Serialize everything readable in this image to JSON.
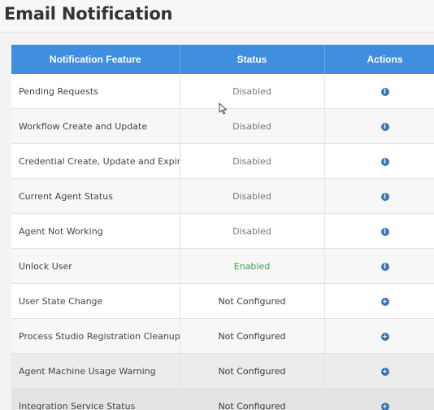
{
  "page": {
    "title": "Email Notification"
  },
  "table": {
    "headers": [
      "Notification Feature",
      "Status",
      "Actions"
    ],
    "rows": [
      {
        "feature": "Pending Requests",
        "status": "Disabled",
        "status_type": "disabled",
        "action_icon": "info-icon",
        "action_glyph": "i"
      },
      {
        "feature": "Workflow Create and Update",
        "status": "Disabled",
        "status_type": "disabled",
        "action_icon": "info-icon",
        "action_glyph": "i"
      },
      {
        "feature": "Credential Create, Update and Expiry",
        "status": "Disabled",
        "status_type": "disabled",
        "action_icon": "info-icon",
        "action_glyph": "i"
      },
      {
        "feature": "Current Agent Status",
        "status": "Disabled",
        "status_type": "disabled",
        "action_icon": "info-icon",
        "action_glyph": "i"
      },
      {
        "feature": "Agent Not Working",
        "status": "Disabled",
        "status_type": "disabled",
        "action_icon": "info-icon",
        "action_glyph": "i"
      },
      {
        "feature": "Unlock User",
        "status": "Enabled",
        "status_type": "enabled",
        "action_icon": "info-icon",
        "action_glyph": "i"
      },
      {
        "feature": "User State Change",
        "status": "Not Configured",
        "status_type": "notcfg",
        "action_icon": "plus-icon",
        "action_glyph": "+"
      },
      {
        "feature": "Process Studio Registration Cleanup",
        "status": "Not Configured",
        "status_type": "notcfg",
        "action_icon": "plus-icon",
        "action_glyph": "+"
      },
      {
        "feature": "Agent Machine Usage Warning",
        "status": "Not Configured",
        "status_type": "notcfg",
        "action_icon": "plus-icon",
        "action_glyph": "+"
      },
      {
        "feature": "Integration Service Status",
        "status": "Not Configured",
        "status_type": "notcfg",
        "action_icon": "plus-icon",
        "action_glyph": "+"
      }
    ]
  },
  "colors": {
    "header_bg": "#3f8fde",
    "icon": "#3c74b5",
    "enabled": "#3fa34d",
    "disabled": "#777777"
  }
}
